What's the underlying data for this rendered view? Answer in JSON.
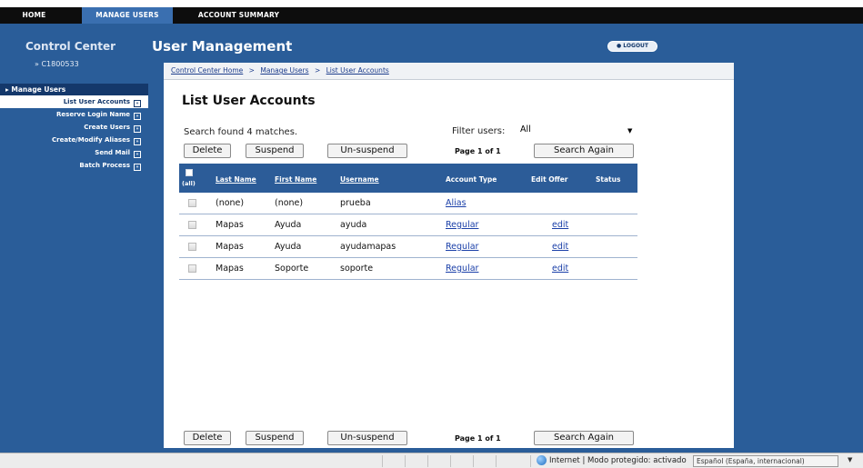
{
  "tabs": {
    "home": "HOME",
    "manage_users": "MANAGE USERS",
    "account_summary": "ACCOUNT SUMMARY"
  },
  "control_center": {
    "title": "Control Center",
    "account_id": "» C1800533"
  },
  "sidebar": {
    "section": "Manage Users",
    "items": [
      {
        "label": "List User Accounts"
      },
      {
        "label": "Reserve Login Name"
      },
      {
        "label": "Create Users"
      },
      {
        "label": "Create/Modify Aliases"
      },
      {
        "label": "Send Mail"
      },
      {
        "label": "Batch Process"
      }
    ]
  },
  "header": {
    "title": "User Management",
    "logout": "● LOGOUT"
  },
  "breadcrumb": {
    "home": "Control Center Home",
    "manage": "Manage Users",
    "list": "List User Accounts",
    "separator": ">"
  },
  "page": {
    "title": "List User Accounts",
    "search_found": "Search found  4  matches.",
    "filter_label": "Filter users:",
    "filter_value": "All",
    "page_info": "Page 1 of 1"
  },
  "buttons": {
    "delete": "Delete",
    "suspend": "Suspend",
    "unsuspend": "Un-suspend",
    "search_again": "Search Again"
  },
  "table": {
    "headers": {
      "all": "(all)",
      "last_name": "Last Name",
      "first_name": "First Name",
      "username": "Username",
      "account_type": "Account Type",
      "edit_offer": "Edit Offer",
      "status": "Status"
    },
    "rows": [
      {
        "last_name": "(none)",
        "first_name": "(none)",
        "username": "prueba",
        "account_type": "Alias",
        "edit_offer": "",
        "status": ""
      },
      {
        "last_name": "Mapas",
        "first_name": "Ayuda",
        "username": "ayuda",
        "account_type": "Regular",
        "edit_offer": "edit",
        "status": ""
      },
      {
        "last_name": "Mapas",
        "first_name": "Ayuda",
        "username": "ayudamapas",
        "account_type": "Regular",
        "edit_offer": "edit",
        "status": ""
      },
      {
        "last_name": "Mapas",
        "first_name": "Soporte",
        "username": "soporte",
        "account_type": "Regular",
        "edit_offer": "edit",
        "status": ""
      }
    ]
  },
  "statusbar": {
    "zone": "Internet | Modo protegido: activado",
    "language": "Español (España, internacional)"
  },
  "colors": {
    "frame_blue": "#2a5d99",
    "sidebar_dark": "#14386b",
    "table_header": "#2c5c98",
    "link": "#1a3fa8"
  }
}
